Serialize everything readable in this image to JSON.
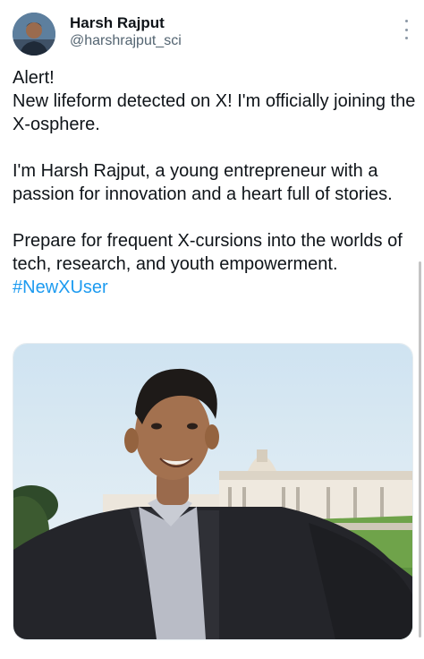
{
  "author": {
    "name": "Harsh Rajput",
    "handle": "@harshrajput_sci"
  },
  "post": {
    "line1": "Alert!",
    "line2": "New lifeform detected on X!  I'm officially joining the X-osphere.",
    "para2": "I'm Harsh Rajput, a young entrepreneur with a passion for innovation and a heart full of stories.",
    "para3": "Prepare for frequent X-cursions into the worlds of tech, research, and youth empowerment.",
    "hashtag": "#NewXUser"
  },
  "icons": {
    "more": "more-options-icon"
  },
  "colors": {
    "text": "#0f1419",
    "secondary": "#536471",
    "link": "#1d9bf0"
  }
}
